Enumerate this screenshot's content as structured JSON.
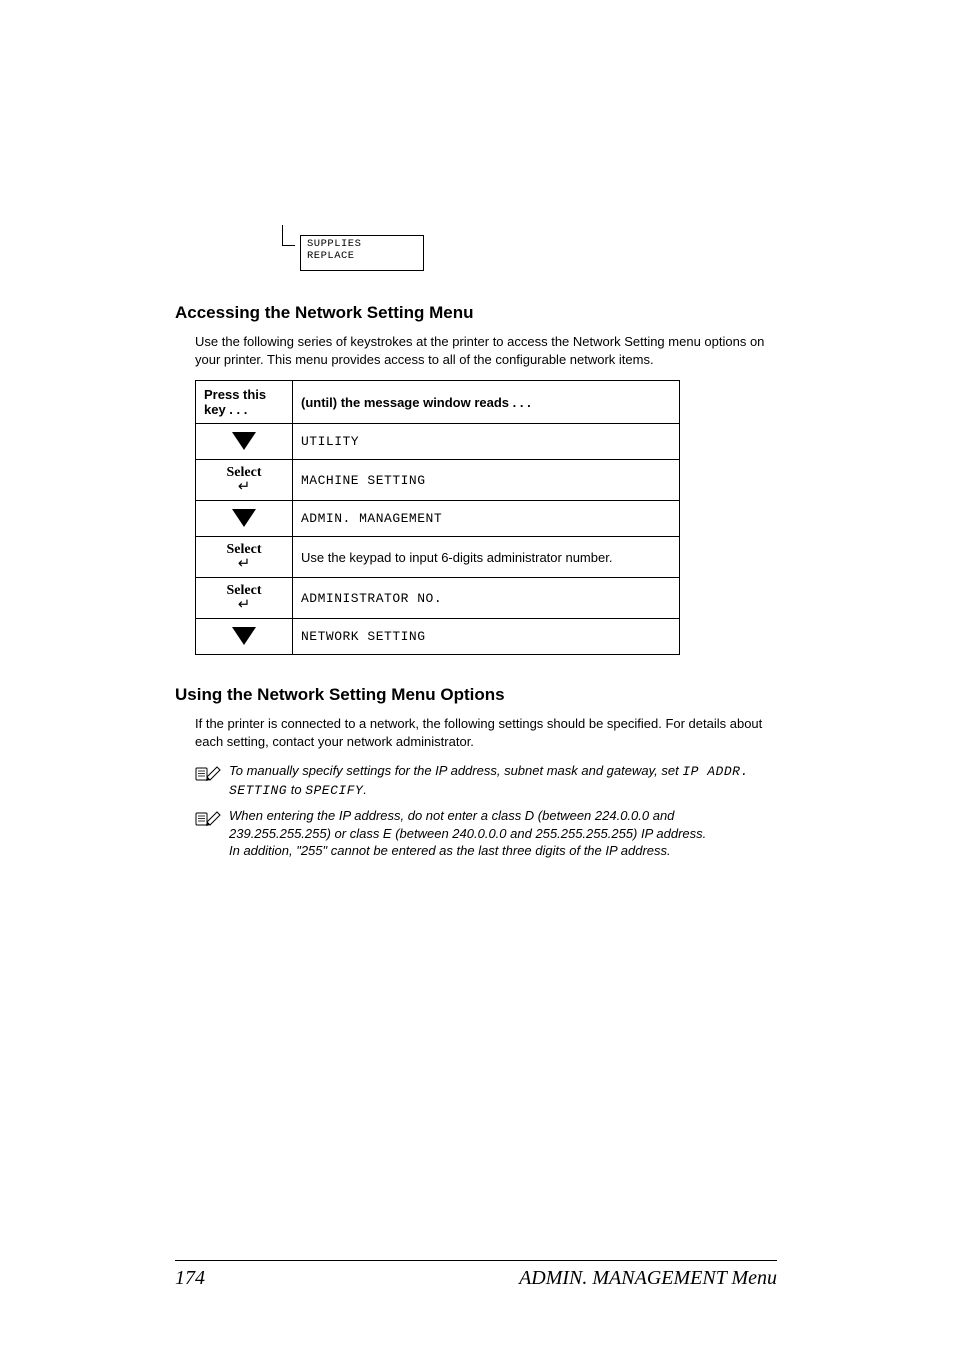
{
  "lcd": {
    "line1": "SUPPLIES",
    "line2": "REPLACE"
  },
  "heading1": "Accessing the Network Setting Menu",
  "intro1": "Use the following series of keystrokes at the printer to access the Network Setting menu options on your printer. This menu provides access to all of the configurable network items.",
  "table": {
    "col1_header": "Press this key . . .",
    "col2_header": "(until) the message window reads . . .",
    "select_label": "Select",
    "rows": {
      "r1": "UTILITY",
      "r2": "MACHINE SETTING",
      "r3": "ADMIN. MANAGEMENT",
      "r4": "Use the keypad to input 6-digits administrator number.",
      "r5": "ADMINISTRATOR NO.",
      "r6": "NETWORK SETTING"
    }
  },
  "heading2": "Using the Network Setting Menu Options",
  "intro2": "If the printer is connected to a network, the following settings should be specified. For details about each setting, contact your network administrator.",
  "note1_a": "To manually specify settings for the IP address, subnet mask and gateway, set ",
  "note1_code1": "IP ADDR. SETTING",
  "note1_b": " to ",
  "note1_code2": "SPECIFY",
  "note1_c": ".",
  "note2_a": "When entering the IP address, do not enter a class D (between 224.0.0.0 and 239.255.255.255) or class E (between 240.0.0.0 and 255.255.255.255) IP address.",
  "note2_b": "In addition, \"255\" cannot be entered as the last three digits of the IP address.",
  "footer": {
    "page": "174",
    "title": "ADMIN. MANAGEMENT Menu"
  }
}
